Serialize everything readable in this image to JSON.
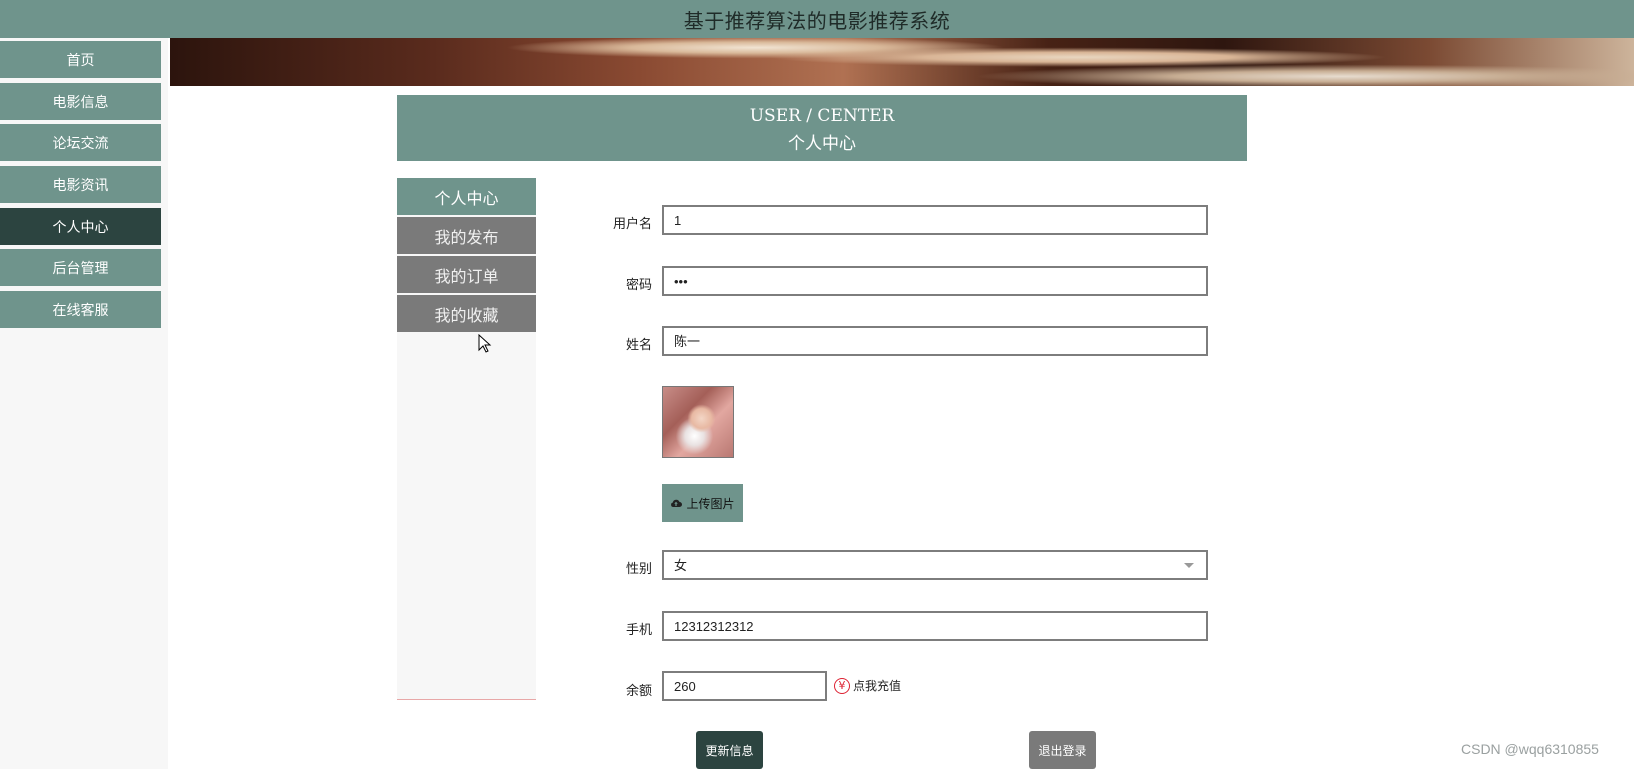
{
  "app_title": "基于推荐算法的电影推荐系统",
  "sidebar": {
    "items": [
      {
        "label": "首页"
      },
      {
        "label": "电影信息"
      },
      {
        "label": "论坛交流"
      },
      {
        "label": "电影资讯"
      },
      {
        "label": "个人中心"
      },
      {
        "label": "后台管理"
      },
      {
        "label": "在线客服"
      }
    ],
    "active": "个人中心"
  },
  "header": {
    "title_en": "USER / CENTER",
    "title_cn": "个人中心"
  },
  "subnav": {
    "items": [
      {
        "label": "个人中心"
      },
      {
        "label": "我的发布"
      },
      {
        "label": "我的订单"
      },
      {
        "label": "我的收藏"
      }
    ],
    "active": "个人中心"
  },
  "form": {
    "username": {
      "label": "用户名",
      "value": "1"
    },
    "password": {
      "label": "密码",
      "value": "•••"
    },
    "name": {
      "label": "姓名",
      "value": "陈一"
    },
    "upload_label": "上传图片",
    "gender": {
      "label": "性别",
      "value": "女"
    },
    "phone": {
      "label": "手机",
      "value": "12312312312"
    },
    "balance": {
      "label": "余额",
      "value": "260"
    },
    "recharge_label": "点我充值",
    "recharge_icon": "¥"
  },
  "actions": {
    "update_label": "更新信息",
    "logout_label": "退出登录"
  },
  "watermark": "CSDN @wqq6310855",
  "colors": {
    "accent": "#6f948c",
    "accent_dark": "#2c4440",
    "gray_button": "#7a7a7a"
  }
}
